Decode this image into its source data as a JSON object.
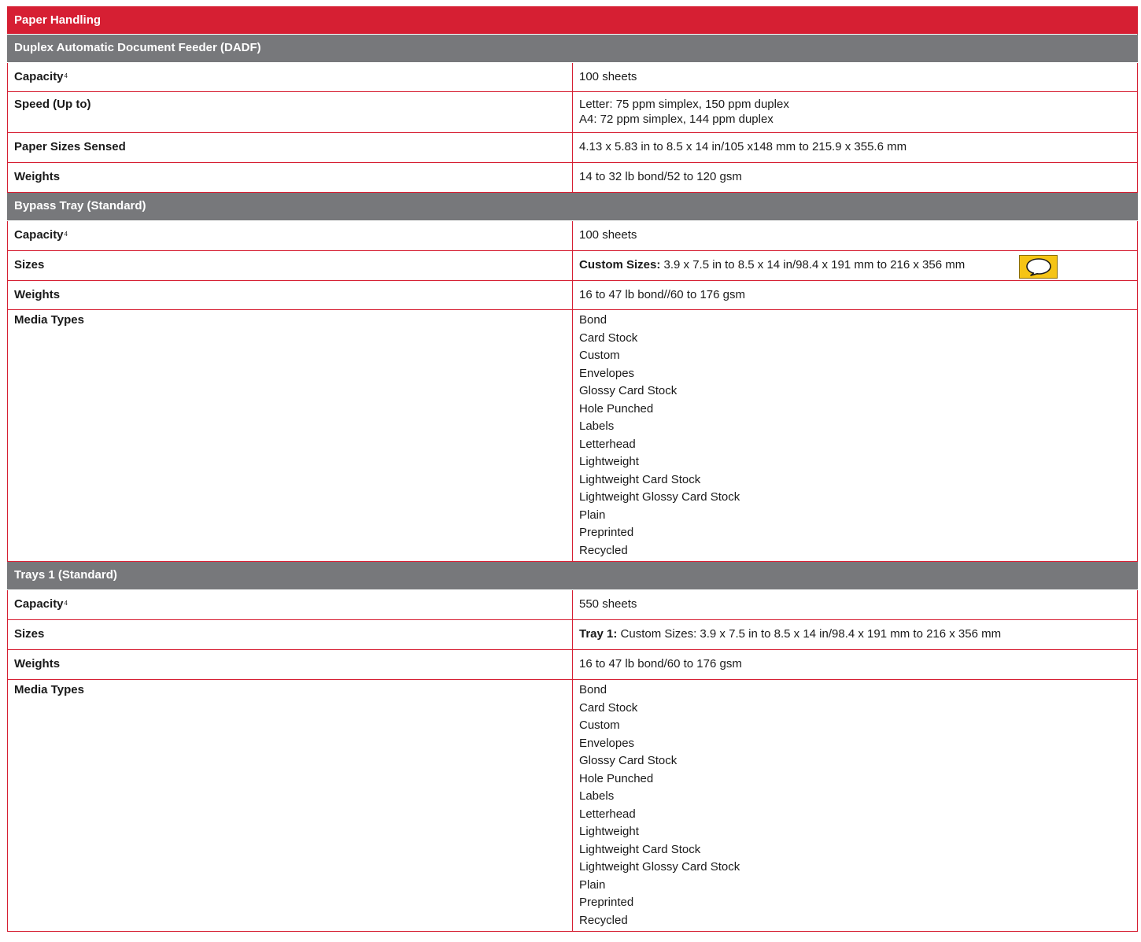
{
  "title": "Paper Handling",
  "colors": {
    "accent_red": "#d61f33",
    "section_gray": "#77787b",
    "comment_yellow": "#f5c415"
  },
  "sections": [
    {
      "heading": "Duplex Automatic Document Feeder (DADF)",
      "rows": [
        {
          "label": "Capacity",
          "footnote": "4",
          "value": "100 sheets"
        },
        {
          "label": "Speed (Up to)",
          "value_lines": [
            "Letter: 75 ppm simplex, 150 ppm duplex",
            "A4: 72 ppm simplex, 144 ppm duplex"
          ]
        },
        {
          "label": "Paper Sizes Sensed",
          "value": "4.13 x 5.83 in to 8.5 x 14 in/105 x148 mm to 215.9 x 355.6 mm"
        },
        {
          "label": "Weights",
          "value": "14 to 32 lb bond/52 to 120 gsm"
        }
      ]
    },
    {
      "heading": "Bypass Tray (Standard)",
      "rows": [
        {
          "label": "Capacity",
          "footnote": "4",
          "value": "100 sheets"
        },
        {
          "label": "Sizes",
          "value_prefix": "Custom Sizes:",
          "value": "3.9 x 7.5 in to 8.5 x 14 in/98.4 x 191 mm to 216 x 356 mm",
          "comment_icon": "speech-bubble-icon"
        },
        {
          "label": "Weights",
          "value": "16 to 47 lb bond//60 to 176 gsm"
        },
        {
          "label": "Media Types",
          "items": [
            "Bond",
            "Card Stock",
            "Custom",
            "Envelopes",
            "Glossy Card Stock",
            "Hole Punched",
            "Labels",
            "Letterhead",
            "Lightweight",
            "Lightweight Card Stock",
            "Lightweight Glossy Card Stock",
            "Plain",
            "Preprinted",
            "Recycled"
          ]
        }
      ]
    },
    {
      "heading": "Trays 1 (Standard)",
      "rows": [
        {
          "label": "Capacity",
          "footnote": "4",
          "value": "550 sheets"
        },
        {
          "label": "Sizes",
          "value_prefix": "Tray 1:",
          "value": "Custom Sizes: 3.9 x 7.5 in to 8.5 x 14 in/98.4 x 191 mm to 216 x 356 mm"
        },
        {
          "label": "Weights",
          "value": "16 to 47 lb bond/60 to 176 gsm"
        },
        {
          "label": "Media Types",
          "items": [
            "Bond",
            "Card Stock",
            "Custom",
            "Envelopes",
            "Glossy Card Stock",
            "Hole Punched",
            "Labels",
            "Letterhead",
            "Lightweight",
            "Lightweight Card Stock",
            "Lightweight Glossy Card Stock",
            "Plain",
            "Preprinted",
            "Recycled"
          ]
        }
      ]
    }
  ]
}
